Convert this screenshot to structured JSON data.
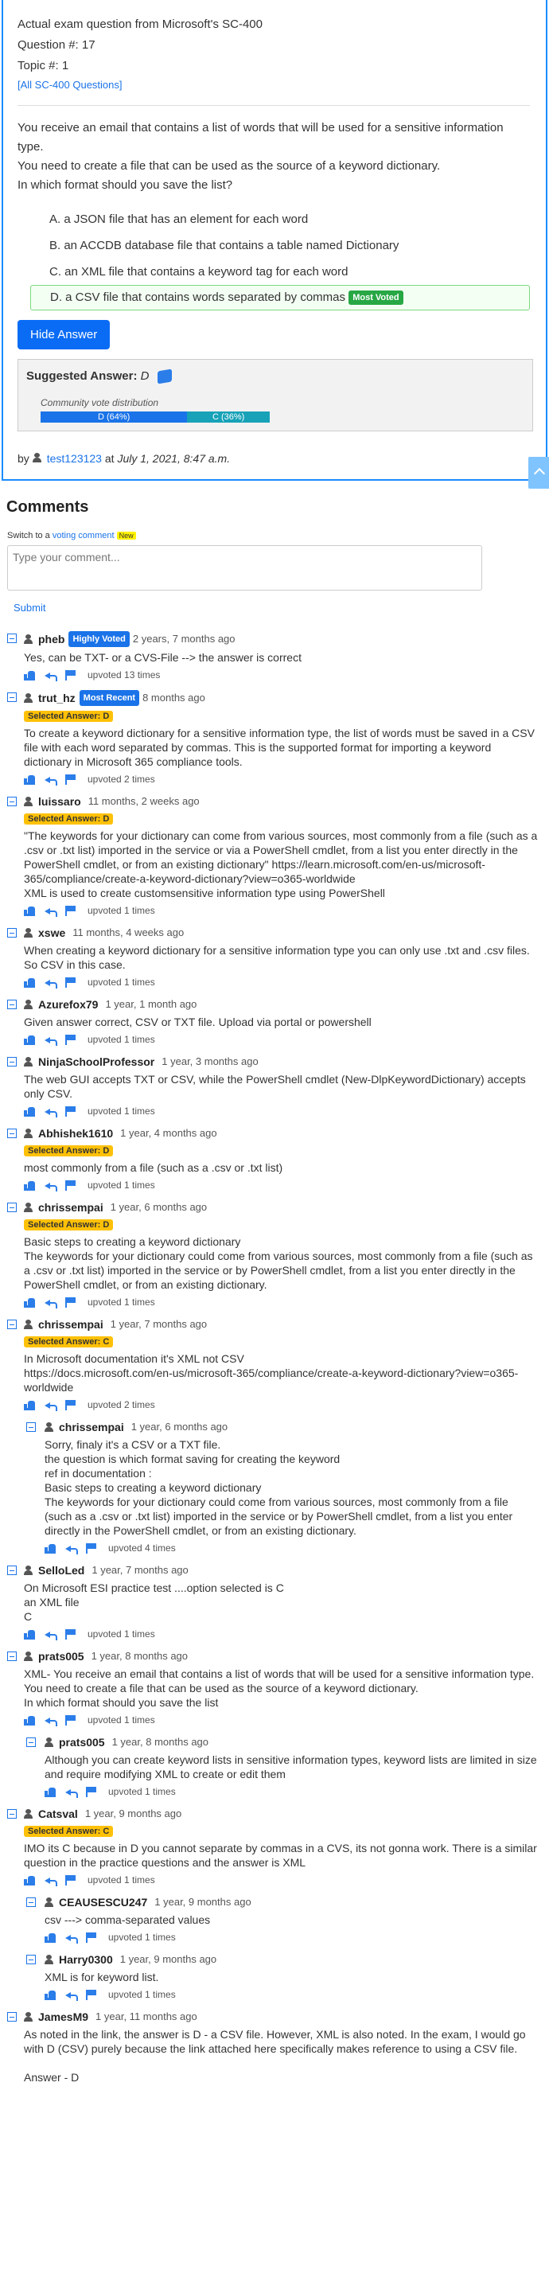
{
  "question": {
    "header": "Actual exam question from Microsoft's SC-400",
    "question_no": "Question #: 17",
    "topic_no": "Topic #: 1",
    "all_link": "[All SC-400 Questions]",
    "text": [
      "You receive an email that contains a list of words that will be used for a sensitive information type.",
      "You need to create a file that can be used as the source of a keyword dictionary.",
      "In which format should you save the list?"
    ],
    "choices": [
      {
        "label": "A. a JSON file that has an element for each word",
        "correct": false
      },
      {
        "label": "B. an ACCDB database file that contains a table named Dictionary",
        "correct": false
      },
      {
        "label": "C. an XML file that contains a keyword tag for each word",
        "correct": false
      },
      {
        "label": "D. a CSV file that contains words separated by commas",
        "correct": true
      }
    ],
    "most_voted": "Most Voted",
    "hide_button": "Hide Answer",
    "suggested_label": "Suggested Answer:",
    "suggested_value": "D",
    "community_label": "Community vote distribution",
    "votes": [
      {
        "label": "D (64%)",
        "percent": 64,
        "color": "#1a73e8"
      },
      {
        "label": "C (36%)",
        "percent": 36,
        "color": "#17a2b8"
      }
    ],
    "by": "by",
    "author": "test123123",
    "at": "at",
    "date": "July 1, 2021, 8:47 a.m."
  },
  "comments_section": {
    "title": "Comments",
    "switch_prefix": "Switch to a",
    "switch_link": "voting comment",
    "new_badge": "New",
    "placeholder": "Type your comment...",
    "submit": "Submit"
  },
  "comments": [
    {
      "user": "pheb",
      "badge": "Highly Voted",
      "date": "2 years, 7 months ago",
      "selected": "",
      "text": "Yes, can be TXT- or a CVS-File --> the answer is correct",
      "upvotes": "upvoted 13 times",
      "reply": false
    },
    {
      "user": "trut_hz",
      "badge": "Most Recent",
      "date": "8 months ago",
      "selected": "Selected Answer: D",
      "text": "To create a keyword dictionary for a sensitive information type, the list of words must be saved in a CSV file with each word separated by commas. This is the supported format for importing a keyword dictionary in Microsoft 365 compliance tools.",
      "upvotes": "upvoted 2 times",
      "reply": false
    },
    {
      "user": "luissaro",
      "badge": "",
      "date": "11 months, 2 weeks ago",
      "selected": "Selected Answer: D",
      "text": "\"The keywords for your dictionary can come from various sources, most commonly from a file (such as a .csv or .txt list) imported in the service or via a PowerShell cmdlet, from a list you enter directly in the PowerShell cmdlet, or from an existing dictionary\" https://learn.microsoft.com/en-us/microsoft-365/compliance/create-a-keyword-dictionary?view=o365-worldwide\nXML is used to create customsensitive information type using PowerShell",
      "upvotes": "upvoted 1 times",
      "reply": false
    },
    {
      "user": "xswe",
      "badge": "",
      "date": "11 months, 4 weeks ago",
      "selected": "",
      "text": "When creating a keyword dictionary for a sensitive information type you can only use .txt and .csv files.\nSo CSV in this case.",
      "upvotes": "upvoted 1 times",
      "reply": false
    },
    {
      "user": "Azurefox79",
      "badge": "",
      "date": "1 year, 1 month ago",
      "selected": "",
      "text": "Given answer correct, CSV or TXT file. Upload via portal or powershell",
      "upvotes": "upvoted 1 times",
      "reply": false
    },
    {
      "user": "NinjaSchoolProfessor",
      "badge": "",
      "date": "1 year, 3 months ago",
      "selected": "",
      "text": "The web GUI accepts TXT or CSV, while the PowerShell cmdlet (New-DlpKeywordDictionary) accepts only CSV.",
      "upvotes": "upvoted 1 times",
      "reply": false
    },
    {
      "user": "Abhishek1610",
      "badge": "",
      "date": "1 year, 4 months ago",
      "selected": "Selected Answer: D",
      "text": "most commonly from a file (such as a .csv or .txt list)",
      "upvotes": "upvoted 1 times",
      "reply": false
    },
    {
      "user": "chrissempai",
      "badge": "",
      "date": "1 year, 6 months ago",
      "selected": "Selected Answer: D",
      "text": "Basic steps to creating a keyword dictionary\nThe keywords for your dictionary could come from various sources, most commonly from a file (such as a .csv or .txt list) imported in the service or by PowerShell cmdlet, from a list you enter directly in the PowerShell cmdlet, or from an existing dictionary.",
      "upvotes": "upvoted 1 times",
      "reply": false
    },
    {
      "user": "chrissempai",
      "badge": "",
      "date": "1 year, 7 months ago",
      "selected": "Selected Answer: C",
      "text": "In Microsoft documentation it's XML not CSV\nhttps://docs.microsoft.com/en-us/microsoft-365/compliance/create-a-keyword-dictionary?view=o365-worldwide",
      "upvotes": "upvoted 2 times",
      "reply": false
    },
    {
      "user": "chrissempai",
      "badge": "",
      "date": "1 year, 6 months ago",
      "selected": "",
      "text": "Sorry, finaly it's a CSV or a TXT file.\nthe question is which format saving for creating the keyword\nref in documentation :\nBasic steps to creating a keyword dictionary\nThe keywords for your dictionary could come from various sources, most commonly from a file (such as a .csv or .txt list) imported in the service or by PowerShell cmdlet, from a list you enter directly in the PowerShell cmdlet, or from an existing dictionary.",
      "upvotes": "upvoted 4 times",
      "reply": true
    },
    {
      "user": "SelloLed",
      "badge": "",
      "date": "1 year, 7 months ago",
      "selected": "",
      "text": "On Microsoft ESI practice test ....option selected is C\nan XML file\nC",
      "upvotes": "upvoted 1 times",
      "reply": false
    },
    {
      "user": "prats005",
      "badge": "",
      "date": "1 year, 8 months ago",
      "selected": "",
      "text": "XML- You receive an email that contains a list of words that will be used for a sensitive information type.\nYou need to create a file that can be used as the source of a keyword dictionary.\nIn which format should you save the list",
      "upvotes": "upvoted 1 times",
      "reply": false
    },
    {
      "user": "prats005",
      "badge": "",
      "date": "1 year, 8 months ago",
      "selected": "",
      "text": "Although you can create keyword lists in sensitive information types, keyword lists are limited in size and require modifying XML to create or edit them",
      "upvotes": "upvoted 1 times",
      "reply": true
    },
    {
      "user": "Catsval",
      "badge": "",
      "date": "1 year, 9 months ago",
      "selected": "Selected Answer: C",
      "text": "IMO its C because in D you cannot separate by commas in a CVS, its not gonna work. There is a similar question in the practice questions and the answer is XML",
      "upvotes": "upvoted 1 times",
      "reply": false
    },
    {
      "user": "CEAUSESCU247",
      "badge": "",
      "date": "1 year, 9 months ago",
      "selected": "",
      "text": "csv ---> comma-separated values",
      "upvotes": "upvoted 1 times",
      "reply": true
    },
    {
      "user": "Harry0300",
      "badge": "",
      "date": "1 year, 9 months ago",
      "selected": "",
      "text": "XML is for keyword list.",
      "upvotes": "upvoted 1 times",
      "reply": true
    },
    {
      "user": "JamesM9",
      "badge": "",
      "date": "1 year, 11 months ago",
      "selected": "",
      "text": "As noted in the link, the answer is D - a CSV file. However, XML is also noted. In the exam, I would go with D (CSV) purely because the link attached here specifically makes reference to using a CSV file.\n\nAnswer - D",
      "upvotes": "",
      "reply": false
    }
  ]
}
